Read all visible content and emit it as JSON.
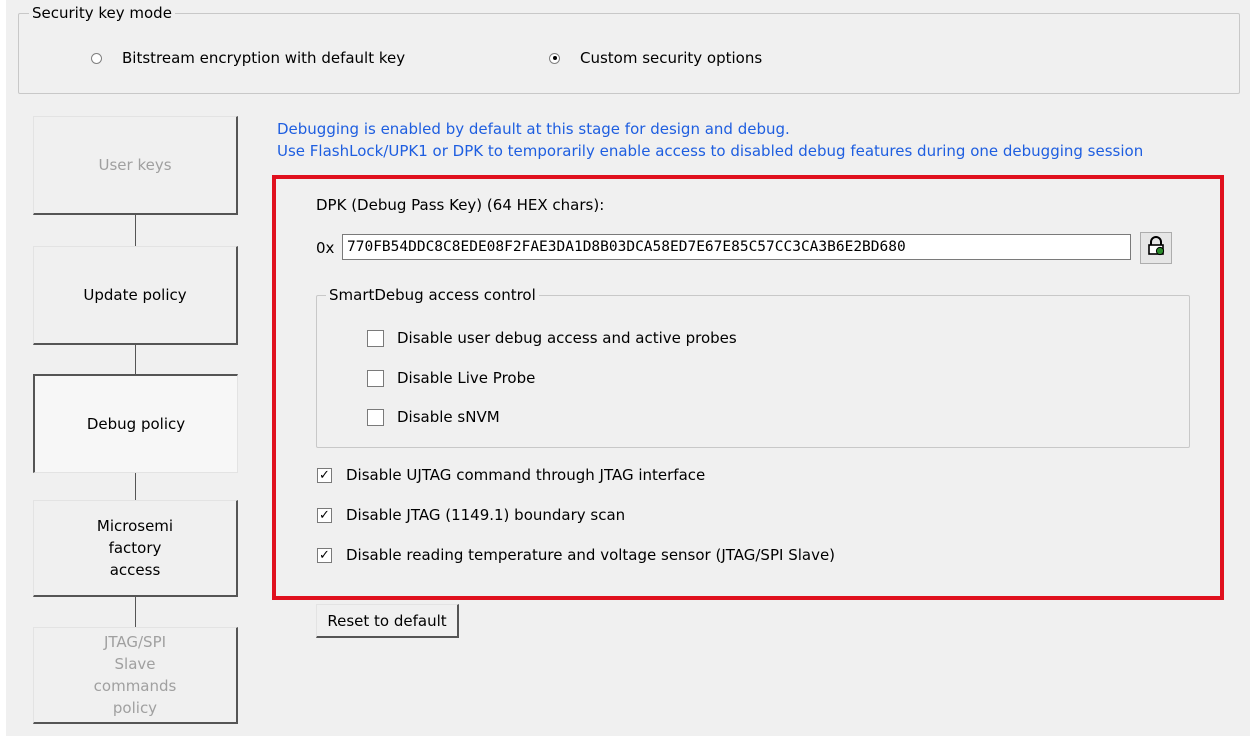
{
  "security_key_mode": {
    "legend": "Security key mode",
    "options": [
      {
        "label": "Bitstream encryption with default key",
        "checked": false
      },
      {
        "label": "Custom security options",
        "checked": true
      }
    ]
  },
  "policy_nav": [
    {
      "label": "User keys",
      "state": "disabled"
    },
    {
      "label": "Update policy",
      "state": "normal"
    },
    {
      "label": "Debug policy",
      "state": "active"
    },
    {
      "label": "Microsemi factory access",
      "state": "normal"
    },
    {
      "label": "JTAG/SPI Slave commands policy",
      "state": "disabled"
    }
  ],
  "info": {
    "line1": "Debugging is enabled by default at this stage for design and debug.",
    "line2": "Use FlashLock/UPK1 or DPK to temporarily enable access to disabled debug features during one debugging session"
  },
  "dpk": {
    "label": "DPK (Debug Pass Key) (64 HEX chars):",
    "prefix": "0x",
    "value": "770FB54DDC8C8EDE08F2FAE3DA1D8B03DCA58ED7E67E85C57CC3CA3B6E2BD680",
    "toggle_icon": "lock-icon"
  },
  "smartdebug": {
    "legend": "SmartDebug access control",
    "options": [
      {
        "label": "Disable user debug access and active probes",
        "checked": false
      },
      {
        "label": "Disable Live Probe",
        "checked": false
      },
      {
        "label": "Disable sNVM",
        "checked": false
      }
    ]
  },
  "other_options": [
    {
      "label": "Disable UJTAG command through JTAG interface",
      "checked": true
    },
    {
      "label": "Disable JTAG (1149.1) boundary scan",
      "checked": true
    },
    {
      "label": "Disable reading temperature and voltage sensor (JTAG/SPI Slave)",
      "checked": true
    }
  ],
  "reset_label": "Reset to default",
  "colors": {
    "highlight": "#e0101e",
    "info_text": "#1e5ee0"
  }
}
